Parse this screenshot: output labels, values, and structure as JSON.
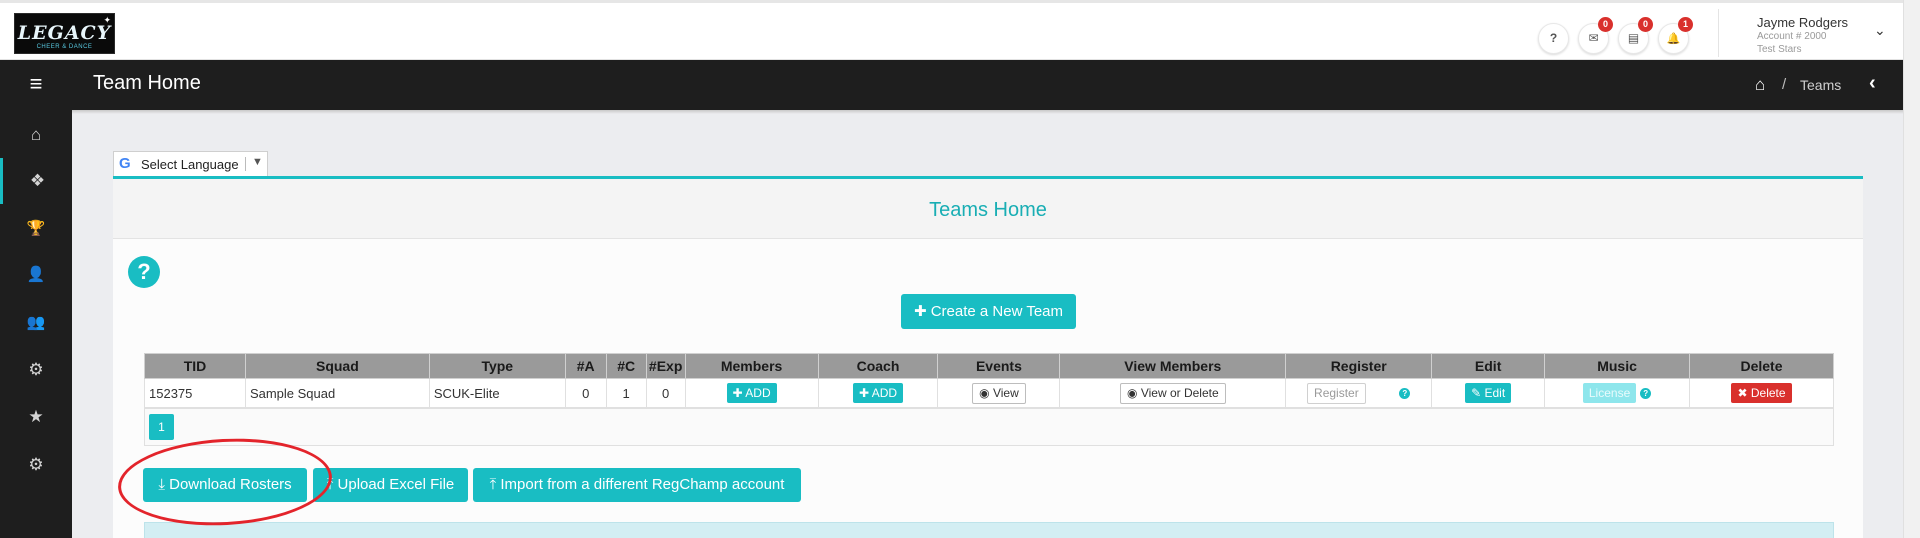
{
  "header": {
    "logo_text": "LEGACY",
    "logo_subtitle": "CHEER & DANCE",
    "icons": [
      {
        "name": "help-icon",
        "glyph": "?",
        "badge": null
      },
      {
        "name": "messages-icon",
        "glyph": "✉",
        "badge": "0"
      },
      {
        "name": "documents-icon",
        "glyph": "▤",
        "badge": "0"
      },
      {
        "name": "bell-icon",
        "glyph": "🔔",
        "badge": "1"
      }
    ],
    "user": {
      "name": "Jayme Rodgers",
      "account": "Account # 2000",
      "team": "Test Stars"
    }
  },
  "sidebar": {
    "items": [
      {
        "icon": "home-icon",
        "glyph": "⌂"
      },
      {
        "icon": "teams-icon",
        "glyph": "❖"
      },
      {
        "icon": "trophy-icon",
        "glyph": "🏆"
      },
      {
        "icon": "add-user-icon",
        "glyph": "👤"
      },
      {
        "icon": "users-icon",
        "glyph": "👥"
      },
      {
        "icon": "gear-icon",
        "glyph": "⚙"
      },
      {
        "icon": "star-icon",
        "glyph": "★"
      },
      {
        "icon": "cogs-icon",
        "glyph": "⚙"
      }
    ]
  },
  "titlebar": {
    "title": "Team Home",
    "breadcrumb_separator": "/",
    "breadcrumb_current": "Teams"
  },
  "language": {
    "label": "Select Language"
  },
  "panel": {
    "title": "Teams Home",
    "create_button": "Create a New Team"
  },
  "table": {
    "headers": [
      "TID",
      "Squad",
      "Type",
      "#A",
      "#C",
      "#Exp",
      "Members",
      "Coach",
      "Events",
      "View Members",
      "Register",
      "Edit",
      "Music",
      "Delete"
    ],
    "rows": [
      {
        "tid": "152375",
        "squad": "Sample Squad",
        "type": "SCUK-Elite",
        "athletes": "0",
        "coaches": "1",
        "exp": "0",
        "members_btn": "ADD",
        "coach_btn": "ADD",
        "events_btn": "View",
        "view_members_btn": "View or Delete",
        "register_btn": "Register",
        "edit_btn": "Edit",
        "music_btn": "License",
        "delete_btn": "Delete"
      }
    ],
    "page": "1"
  },
  "actions": {
    "download": "Download Rosters",
    "upload": "Upload Excel File",
    "import": "Import from a different RegChamp account"
  }
}
